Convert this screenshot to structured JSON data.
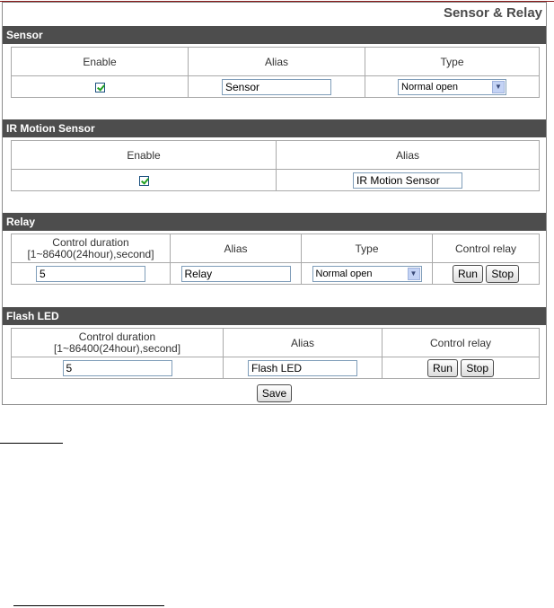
{
  "page_title": "Sensor & Relay",
  "sensor": {
    "section_title": "Sensor",
    "headers": [
      "Enable",
      "Alias",
      "Type"
    ],
    "enabled": true,
    "alias": "Sensor",
    "type": "Normal open"
  },
  "ir_motion": {
    "section_title": "IR Motion Sensor",
    "headers": [
      "Enable",
      "Alias"
    ],
    "enabled": true,
    "alias": "IR Motion Sensor"
  },
  "relay": {
    "section_title": "Relay",
    "header_duration_line1": "Control duration",
    "header_duration_line2": "[1~86400(24hour),second]",
    "header_alias": "Alias",
    "header_type": "Type",
    "header_control": "Control relay",
    "duration": "5",
    "alias": "Relay",
    "type": "Normal open",
    "run_label": "Run",
    "stop_label": "Stop"
  },
  "flash_led": {
    "section_title": "Flash LED",
    "header_duration_line1": "Control duration",
    "header_duration_line2": "[1~86400(24hour),second]",
    "header_alias": "Alias",
    "header_control": "Control relay",
    "duration": "5",
    "alias": "Flash LED",
    "run_label": "Run",
    "stop_label": "Stop"
  },
  "save_label": "Save",
  "colors": {
    "section_bar": "#4d4d4d",
    "checkbox_mark": "#21a121",
    "input_border": "#7f9db9"
  }
}
